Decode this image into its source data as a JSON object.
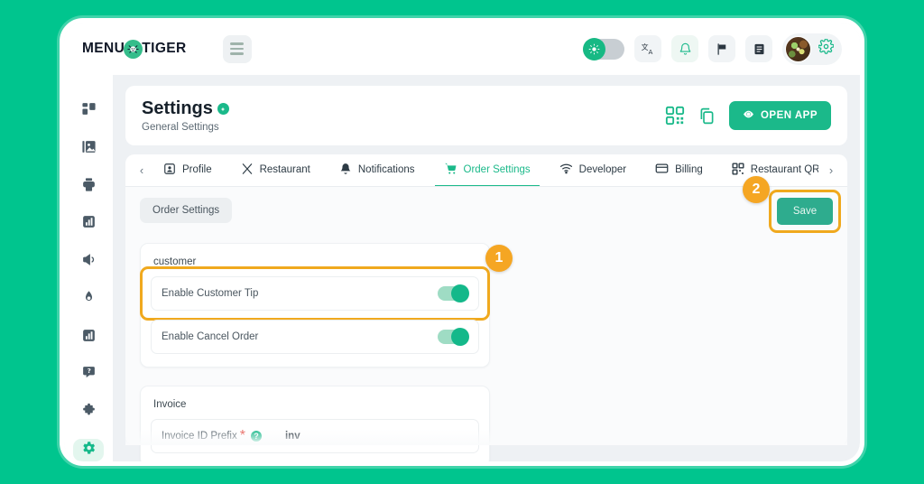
{
  "brand": {
    "logo_text_left": "MENU",
    "logo_text_right": "TIGER",
    "logo_mark": "tiger-face-icon",
    "accent_color": "#1bb98a",
    "page_background": "#00c58e"
  },
  "topbar": {
    "menu_icon": "hamburger-menu-icon",
    "theme_toggle": {
      "name": "theme-toggle",
      "state": "on",
      "icon": "sun-icon"
    },
    "icons": [
      {
        "name": "translate-icon",
        "glyph": "文A"
      },
      {
        "name": "notification-bell-icon"
      },
      {
        "name": "flag-icon"
      },
      {
        "name": "document-icon"
      }
    ],
    "avatar": "user-avatar",
    "settings_gear": "gear-icon"
  },
  "sidebar": {
    "items": [
      {
        "name": "dashboard-icon",
        "active": false
      },
      {
        "name": "image-gallery-icon",
        "active": false
      },
      {
        "name": "printer-icon",
        "active": false
      },
      {
        "name": "analytics-icon",
        "active": false
      },
      {
        "name": "megaphone-icon",
        "active": false
      },
      {
        "name": "flame-icon",
        "active": false
      },
      {
        "name": "bar-chart-icon",
        "active": false
      },
      {
        "name": "feedback-icon",
        "active": false
      },
      {
        "name": "puzzle-icon",
        "active": false
      },
      {
        "name": "settings-gear-icon",
        "active": true
      }
    ]
  },
  "page": {
    "title": "Settings",
    "title_badge": "info-badge",
    "subtitle": "General Settings",
    "actions": {
      "qr_icon": "qr-code-icon",
      "copy_icon": "copy-icon",
      "open_app_label": "OPEN APP",
      "open_app_icon": "eye-icon"
    }
  },
  "tabs": {
    "prev_arrow": "‹",
    "next_arrow": "›",
    "items": [
      {
        "label": "Profile",
        "icon": "profile-icon",
        "active": false
      },
      {
        "label": "Restaurant",
        "icon": "utensils-icon",
        "active": false
      },
      {
        "label": "Notifications",
        "icon": "bell-icon",
        "active": false
      },
      {
        "label": "Order Settings",
        "icon": "shopping-cart-icon",
        "active": true
      },
      {
        "label": "Developer",
        "icon": "wifi-icon",
        "active": false
      },
      {
        "label": "Billing",
        "icon": "credit-card-icon",
        "active": false
      },
      {
        "label": "Restaurant QR C",
        "icon": "qr-code-icon",
        "active": false
      }
    ]
  },
  "panel": {
    "subtab_label": "Order Settings",
    "save_label": "Save",
    "sections": [
      {
        "title": "customer",
        "rows": [
          {
            "label": "Enable Customer Tip",
            "type": "toggle",
            "state": "on",
            "highlighted": true
          },
          {
            "label": "Enable Cancel Order",
            "type": "toggle",
            "state": "on",
            "highlighted": false
          }
        ]
      },
      {
        "title": "Invoice",
        "rows": [
          {
            "label": "Invoice ID Prefix",
            "required": "*",
            "help": "?",
            "type": "text",
            "value": "inv"
          }
        ]
      }
    ]
  },
  "annotations": [
    {
      "number": "1",
      "target": "enable-customer-tip-toggle",
      "color": "#f5a623"
    },
    {
      "number": "2",
      "target": "save-button",
      "color": "#f5a623"
    }
  ]
}
